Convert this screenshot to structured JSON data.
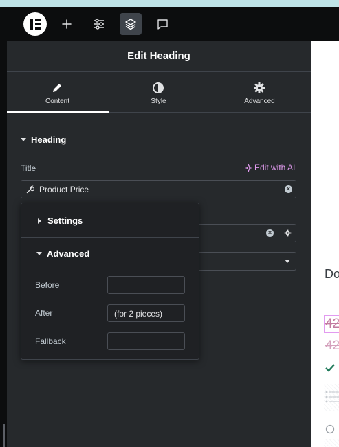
{
  "topbar": {
    "logo": "elementor-logo",
    "buttons": [
      {
        "name": "add-element",
        "icon": "plus-icon"
      },
      {
        "name": "site-settings",
        "icon": "sliders-icon"
      },
      {
        "name": "structure",
        "icon": "layers-icon",
        "active": true
      },
      {
        "name": "notes",
        "icon": "comment-icon"
      }
    ]
  },
  "panel": {
    "title": "Edit Heading",
    "tabs": [
      {
        "label": "Content",
        "icon": "pencil-icon",
        "active": true
      },
      {
        "label": "Style",
        "icon": "contrast-icon",
        "active": false
      },
      {
        "label": "Advanced",
        "icon": "gear-icon",
        "active": false
      }
    ],
    "section": "Heading",
    "title_label": "Title",
    "ai_link": "Edit with AI",
    "title_value": "Product Price"
  },
  "popover": {
    "settings_label": "Settings",
    "advanced_label": "Advanced",
    "before_label": "Before",
    "before_value": "",
    "after_label": "After",
    "after_value": "(for 2 pieces)",
    "fallback_label": "Fallback",
    "fallback_value": ""
  },
  "preview": {
    "partial_text": "Do",
    "price_1": "42",
    "price_2": "42"
  },
  "colors": {
    "accent_ai": "#e29bf0",
    "panel_bg": "#26292c",
    "topbar_bg": "#0c0d0e",
    "check": "#1f7a5a"
  }
}
